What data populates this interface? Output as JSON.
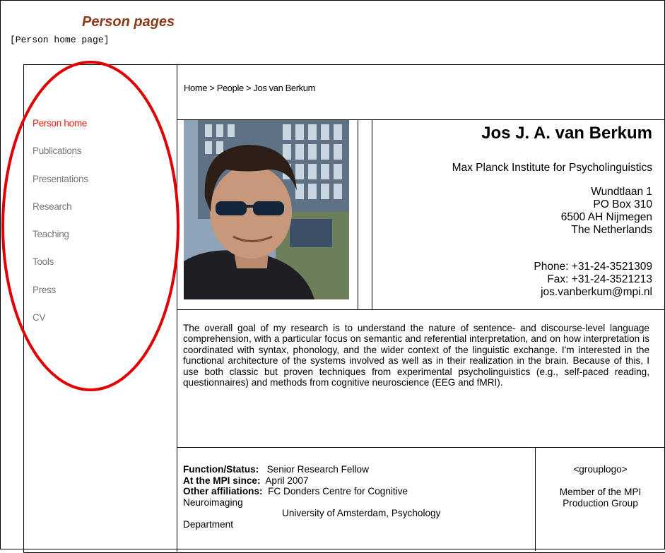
{
  "header": {
    "title": "Person pages",
    "subtitle": "[Person home page]"
  },
  "nav": {
    "items": [
      {
        "label": "Person home",
        "active": true
      },
      {
        "label": "Publications",
        "active": false
      },
      {
        "label": "Presentations",
        "active": false
      },
      {
        "label": "Research",
        "active": false
      },
      {
        "label": "Teaching",
        "active": false
      },
      {
        "label": "Tools",
        "active": false
      },
      {
        "label": "Press",
        "active": false
      },
      {
        "label": "CV",
        "active": false
      }
    ]
  },
  "breadcrumb": {
    "home": "Home",
    "people": "People",
    "current": "Jos van Berkum",
    "separator": " > "
  },
  "person": {
    "name": "Jos J. A. van Berkum",
    "institute": "Max Planck Institute for Psycholinguistics",
    "address": [
      "Wundtlaan 1",
      "PO Box 310",
      "6500 AH Nijmegen",
      "The Netherlands"
    ],
    "phone": "Phone: +31-24-3521309",
    "fax": "Fax: +31-24-3521213",
    "email": "jos.vanberkum@mpi.nl"
  },
  "bio": "The overall goal of my research is to understand the nature of sentence- and discourse-level language comprehension, with a particular focus on semantic and referential interpretation, and on how interpretation is coordinated with syntax, phonology, and the wider context of the linguistic exchange. I'm interested in the functional architecture of the systems involved as well as in their realization in the brain. Because of this, I use both classic but proven techniques from experimental psycholinguistics (e.g., self-paced reading, questionnaires) and methods from cognitive neuroscience (EEG and fMRI).",
  "info": {
    "function_label": "Function/Status:",
    "function_value": "Senior Research Fellow",
    "since_label": "At the MPI since:",
    "since_value": "April 2007",
    "affiliations_label": "Other affiliations:",
    "affiliation_1a": "FC Donders Centre for Cognitive",
    "affiliation_1b": "Neuroimaging",
    "affiliation_2a": "University of Amsterdam, Psychology",
    "affiliation_2b": "Department"
  },
  "group": {
    "logo": "<grouplogo>",
    "member_line1": "Member of the MPI",
    "member_line2": "Production Group"
  },
  "colors": {
    "title": "#8b3a1a",
    "nav_active": "#e8190f",
    "nav_inactive": "#777777",
    "annotation_ellipse": "#e00000"
  }
}
